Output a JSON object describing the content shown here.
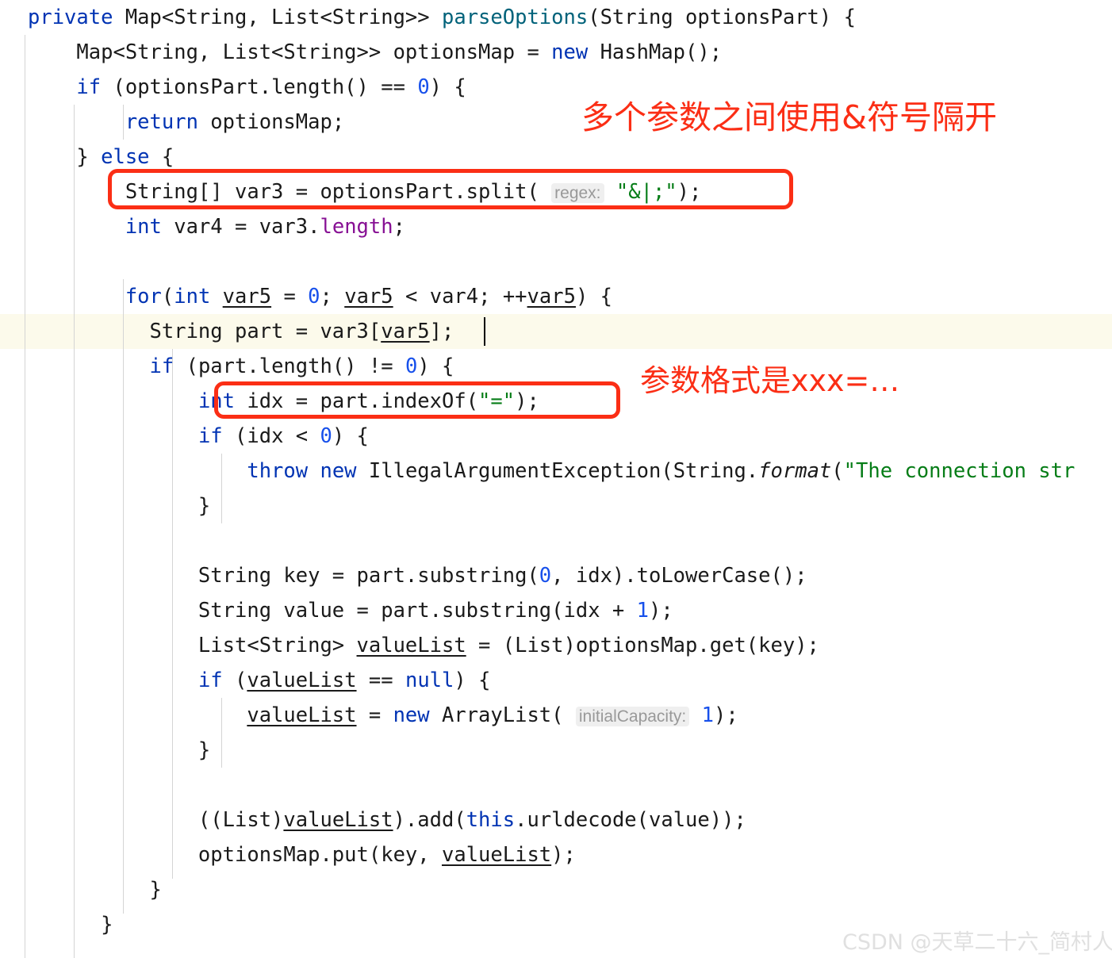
{
  "editor": {
    "language": "java",
    "background_color": "#ffffff",
    "current_line_color": "#fcfaeb",
    "indent_guide_color": "#d4d4d4",
    "caret_color": "#000000",
    "colors": {
      "keyword": "#0033b3",
      "number": "#1750eb",
      "string": "#067d17",
      "method": "#00627a",
      "field": "#871094",
      "plain_text": "#1a1a1a",
      "inlay_hint_bg": "#efefef",
      "inlay_hint_fg": "#999999",
      "annotation_red": "#fb2e15",
      "watermark": "#e0e0e0"
    },
    "current_line_index": 9
  },
  "code_lines": [
    {
      "indent": 0,
      "text": "private Map<String, List<String>> parseOptions(String optionsPart) {"
    },
    {
      "indent": 1,
      "text": "Map<String, List<String>> optionsMap = new HashMap();"
    },
    {
      "indent": 1,
      "text": "if (optionsPart.length() == 0) {"
    },
    {
      "indent": 2,
      "text": "return optionsMap;"
    },
    {
      "indent": 1,
      "text": "} else {"
    },
    {
      "indent": 2,
      "text": "String[] var3 = optionsPart.split( regex: \"&|;\");"
    },
    {
      "indent": 2,
      "text": "int var4 = var3.length;"
    },
    {
      "indent": 0,
      "text": ""
    },
    {
      "indent": 2,
      "text": "for(int var5 = 0; var5 < var4; ++var5) {"
    },
    {
      "indent": 3,
      "text": "String part = var3[var5];"
    },
    {
      "indent": 3,
      "text": "if (part.length() != 0) {"
    },
    {
      "indent": 4,
      "text": "int idx = part.indexOf(\"=\");"
    },
    {
      "indent": 4,
      "text": "if (idx < 0) {"
    },
    {
      "indent": 5,
      "text": "throw new IllegalArgumentException(String.format(\"The connection str"
    },
    {
      "indent": 4,
      "text": "}"
    },
    {
      "indent": 0,
      "text": ""
    },
    {
      "indent": 4,
      "text": "String key = part.substring(0, idx).toLowerCase();"
    },
    {
      "indent": 4,
      "text": "String value = part.substring(idx + 1);"
    },
    {
      "indent": 4,
      "text": "List<String> valueList = (List)optionsMap.get(key);"
    },
    {
      "indent": 4,
      "text": "if (valueList == null) {"
    },
    {
      "indent": 5,
      "text": "valueList = new ArrayList( initialCapacity: 1);"
    },
    {
      "indent": 4,
      "text": "}"
    },
    {
      "indent": 0,
      "text": ""
    },
    {
      "indent": 4,
      "text": "((List)valueList).add(this.urldecode(value));"
    },
    {
      "indent": 4,
      "text": "optionsMap.put(key, valueList);"
    },
    {
      "indent": 3,
      "text": "}"
    },
    {
      "indent": 2,
      "text": "}"
    }
  ],
  "inlay_hints": [
    {
      "label": "regex:",
      "line": 5
    },
    {
      "label": "initialCapacity:",
      "line": 20
    }
  ],
  "annotations": {
    "box_1_label": "highlight-split-call",
    "box_2_label": "highlight-indexof-call",
    "note_1": "多个参数之间使用&符号隔开",
    "note_2": "参数格式是xxx=…"
  },
  "watermark": {
    "text": "CSDN @天草二十六_简村人"
  }
}
